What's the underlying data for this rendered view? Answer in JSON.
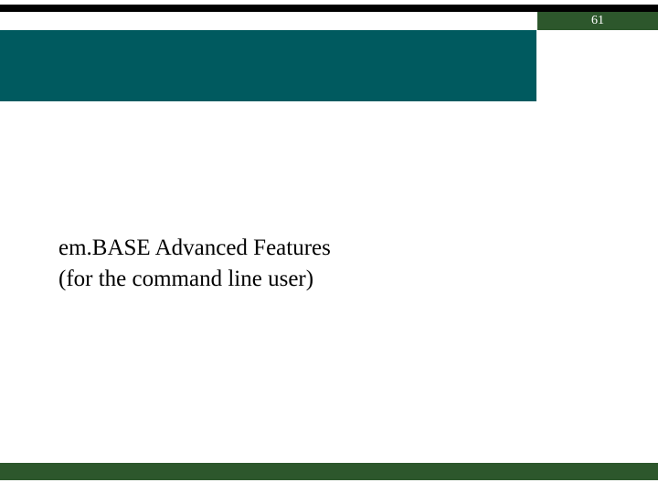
{
  "header": {
    "page_number": "61"
  },
  "content": {
    "title_line1": "em.BASE Advanced Features",
    "title_line2": "(for the command line user)"
  }
}
